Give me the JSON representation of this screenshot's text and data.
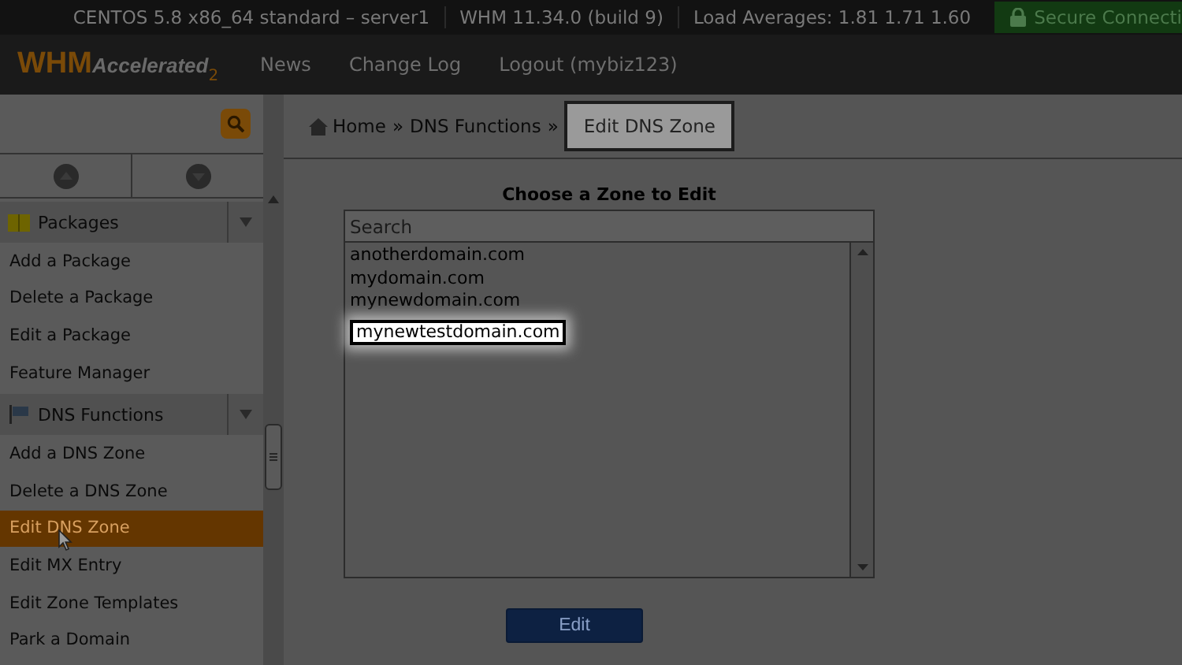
{
  "top_bar": {
    "items": [
      "CENTOS 5.8 x86_64 standard – server1",
      "WHM 11.34.0 (build 9)",
      "Load Averages: 1.81 1.71 1.60"
    ],
    "secure": "Secure Connecti"
  },
  "header": {
    "logo": {
      "main": "WHM",
      "sub": "Accelerated",
      "version": "2"
    },
    "nav": [
      "News",
      "Change Log",
      "Logout (mybiz123)"
    ]
  },
  "sidebar": {
    "groups": [
      {
        "title": "Packages",
        "kind": "package",
        "items": [
          {
            "label": "Add a Package",
            "selected": false
          },
          {
            "label": "Delete a Package",
            "selected": false
          },
          {
            "label": "Edit a Package",
            "selected": false
          },
          {
            "label": "Feature Manager",
            "selected": false
          }
        ]
      },
      {
        "title": "DNS Functions",
        "kind": "dns",
        "items": [
          {
            "label": "Add a DNS Zone",
            "selected": false
          },
          {
            "label": "Delete a DNS Zone",
            "selected": false
          },
          {
            "label": "Edit DNS Zone",
            "selected": true
          },
          {
            "label": "Edit MX Entry",
            "selected": false
          },
          {
            "label": "Edit Zone Templates",
            "selected": false
          },
          {
            "label": "Park a Domain",
            "selected": false
          }
        ]
      }
    ]
  },
  "breadcrumb_separator": "»",
  "breadcrumb": [
    {
      "label": "Home",
      "highlighted": false
    },
    {
      "label": "DNS Functions",
      "highlighted": false
    },
    {
      "label": "Edit DNS Zone",
      "highlighted": true
    }
  ],
  "zone_picker": {
    "title": "Choose a Zone to Edit",
    "search": {
      "placeholder": "Search"
    },
    "zones": [
      {
        "name": "anotherdomain.com",
        "selected": false
      },
      {
        "name": "mydomain.com",
        "selected": false
      },
      {
        "name": "mynewdomain.com",
        "selected": false
      },
      {
        "name": "mynewtestdomain.com",
        "selected": true
      }
    ],
    "button": "Edit"
  }
}
